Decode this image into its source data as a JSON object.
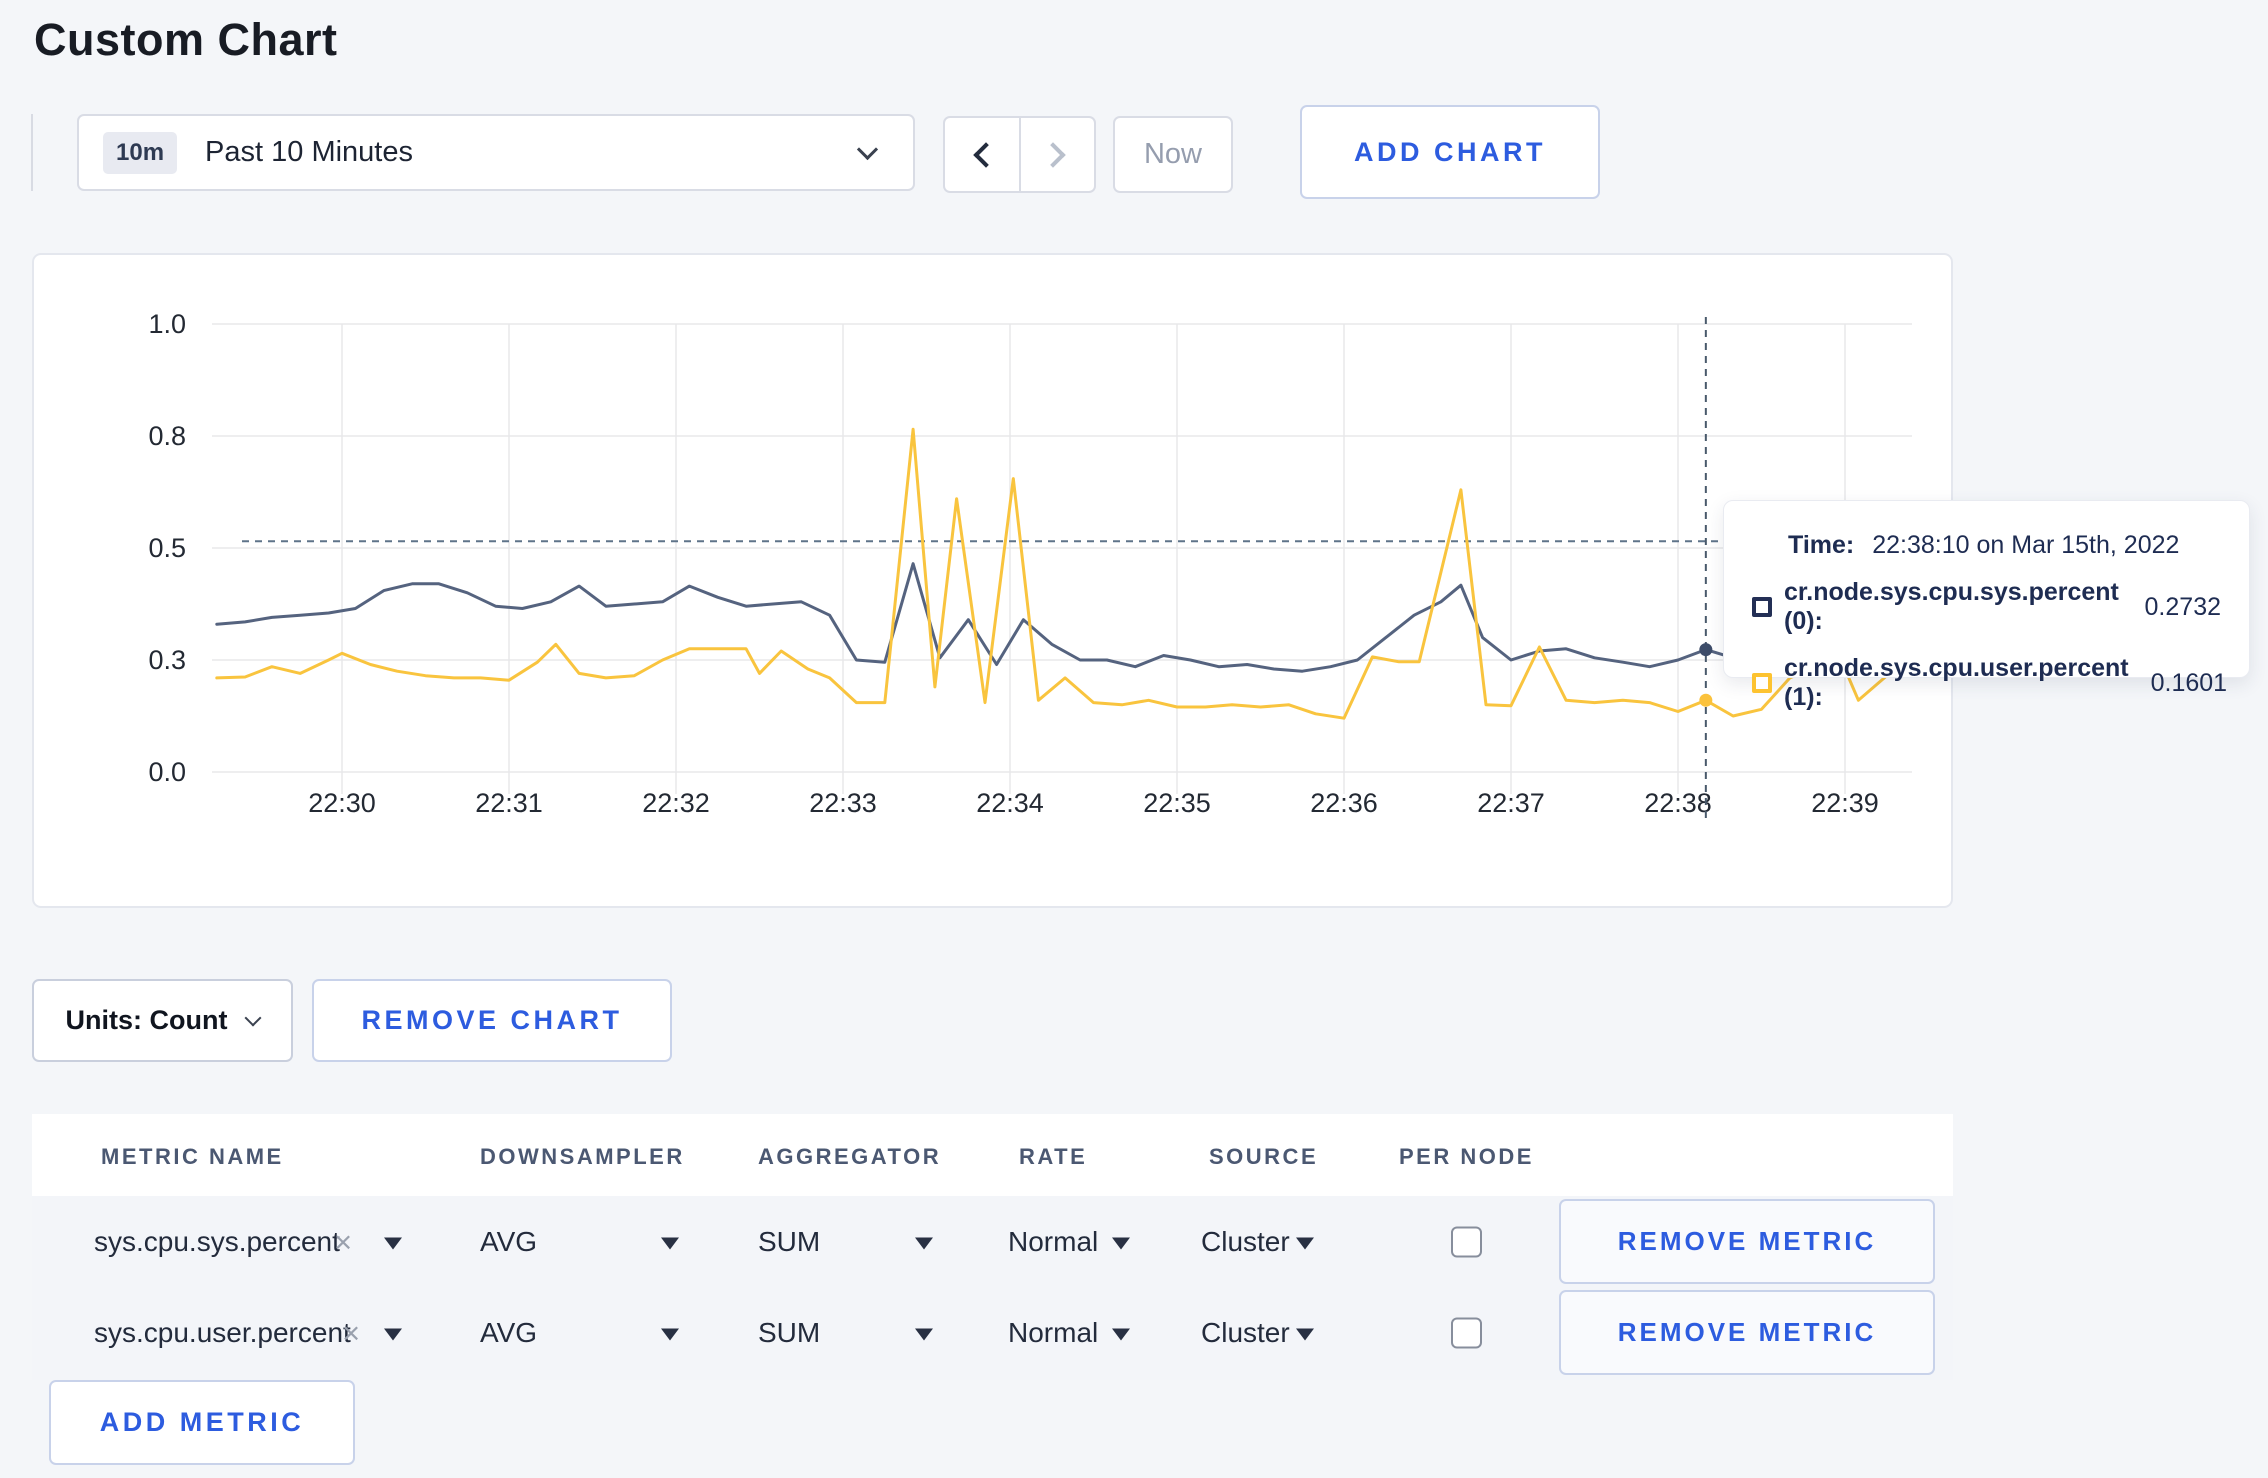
{
  "page": {
    "title": "Custom Chart"
  },
  "toolbar": {
    "time_badge": "10m",
    "time_range_label": "Past 10 Minutes",
    "now_label": "Now",
    "add_chart_label": "ADD CHART"
  },
  "tooltip": {
    "time_label": "Time:",
    "time_value": "22:38:10 on Mar 15th, 2022",
    "rows": [
      {
        "label": "cr.node.sys.cpu.sys.percent (0):",
        "value": "0.2732",
        "swatch_color": "#232f55"
      },
      {
        "label": "cr.node.sys.cpu.user.percent (1):",
        "value": "0.1601",
        "swatch_color": "#fdc330"
      }
    ]
  },
  "chart_data": {
    "type": "line",
    "title": "",
    "xlabel": "",
    "ylabel": "",
    "ylim": [
      0,
      1
    ],
    "grid": true,
    "grid_color": "#e8e8ea",
    "y_axis": {
      "ticks": [
        {
          "v": 0.0,
          "label": "0.0"
        },
        {
          "v": 0.25,
          "label": "0.3"
        },
        {
          "v": 0.5,
          "label": "0.5"
        },
        {
          "v": 0.75,
          "label": "0.8"
        },
        {
          "v": 1.0,
          "label": "1.0"
        }
      ]
    },
    "x_axis": {
      "ticks": [
        {
          "m": 0,
          "label": "22:30"
        },
        {
          "m": 1,
          "label": "22:31"
        },
        {
          "m": 2,
          "label": "22:32"
        },
        {
          "m": 3,
          "label": "22:33"
        },
        {
          "m": 4,
          "label": "22:34"
        },
        {
          "m": 5,
          "label": "22:35"
        },
        {
          "m": 6,
          "label": "22:36"
        },
        {
          "m": 7,
          "label": "22:37"
        },
        {
          "m": 8,
          "label": "22:38"
        },
        {
          "m": 9,
          "label": "22:39"
        }
      ]
    },
    "series": [
      {
        "name": "cr.node.sys.cpu.sys.percent",
        "color": "#55637f",
        "dot_color": "#3d4c69",
        "points": [
          [
            -0.75,
            0.33
          ],
          [
            -0.58,
            0.335
          ],
          [
            -0.42,
            0.345
          ],
          [
            -0.25,
            0.35
          ],
          [
            -0.08,
            0.355
          ],
          [
            0.08,
            0.365
          ],
          [
            0.25,
            0.405
          ],
          [
            0.42,
            0.42
          ],
          [
            0.58,
            0.42
          ],
          [
            0.75,
            0.4
          ],
          [
            0.92,
            0.37
          ],
          [
            1.08,
            0.365
          ],
          [
            1.25,
            0.38
          ],
          [
            1.42,
            0.415
          ],
          [
            1.58,
            0.37
          ],
          [
            1.75,
            0.375
          ],
          [
            1.92,
            0.38
          ],
          [
            2.08,
            0.415
          ],
          [
            2.25,
            0.39
          ],
          [
            2.42,
            0.37
          ],
          [
            2.58,
            0.375
          ],
          [
            2.75,
            0.38
          ],
          [
            2.92,
            0.35
          ],
          [
            3.08,
            0.25
          ],
          [
            3.25,
            0.245
          ],
          [
            3.42,
            0.465
          ],
          [
            3.58,
            0.255
          ],
          [
            3.75,
            0.34
          ],
          [
            3.92,
            0.24
          ],
          [
            4.08,
            0.34
          ],
          [
            4.25,
            0.285
          ],
          [
            4.42,
            0.25
          ],
          [
            4.58,
            0.25
          ],
          [
            4.75,
            0.235
          ],
          [
            4.92,
            0.26
          ],
          [
            5.08,
            0.25
          ],
          [
            5.25,
            0.235
          ],
          [
            5.42,
            0.24
          ],
          [
            5.58,
            0.23
          ],
          [
            5.75,
            0.225
          ],
          [
            5.92,
            0.235
          ],
          [
            6.08,
            0.25
          ],
          [
            6.25,
            0.3
          ],
          [
            6.42,
            0.35
          ],
          [
            6.58,
            0.38
          ],
          [
            6.7,
            0.417
          ],
          [
            6.83,
            0.3
          ],
          [
            7.0,
            0.25
          ],
          [
            7.17,
            0.27
          ],
          [
            7.33,
            0.275
          ],
          [
            7.5,
            0.255
          ],
          [
            7.67,
            0.245
          ],
          [
            7.83,
            0.235
          ],
          [
            8.0,
            0.25
          ],
          [
            8.1667,
            0.2732
          ],
          [
            8.33,
            0.255
          ],
          [
            8.5,
            0.26
          ],
          [
            8.67,
            0.275
          ],
          [
            8.83,
            0.305
          ],
          [
            8.97,
            0.315
          ],
          [
            9.08,
            0.29
          ],
          [
            9.25,
            0.275
          ]
        ]
      },
      {
        "name": "cr.node.sys.cpu.user.percent",
        "color": "#f9c43e",
        "dot_color": "#fbc23c",
        "points": [
          [
            -0.75,
            0.21
          ],
          [
            -0.58,
            0.212
          ],
          [
            -0.42,
            0.235
          ],
          [
            -0.25,
            0.22
          ],
          [
            -0.08,
            0.25
          ],
          [
            0,
            0.265
          ],
          [
            0.17,
            0.24
          ],
          [
            0.33,
            0.225
          ],
          [
            0.5,
            0.215
          ],
          [
            0.67,
            0.21
          ],
          [
            0.83,
            0.21
          ],
          [
            1.0,
            0.205
          ],
          [
            1.17,
            0.245
          ],
          [
            1.28,
            0.285
          ],
          [
            1.42,
            0.22
          ],
          [
            1.58,
            0.21
          ],
          [
            1.75,
            0.215
          ],
          [
            1.92,
            0.25
          ],
          [
            2.08,
            0.275
          ],
          [
            2.25,
            0.275
          ],
          [
            2.42,
            0.275
          ],
          [
            2.5,
            0.22
          ],
          [
            2.63,
            0.27
          ],
          [
            2.79,
            0.23
          ],
          [
            2.92,
            0.21
          ],
          [
            3.08,
            0.155
          ],
          [
            3.25,
            0.155
          ],
          [
            3.42,
            0.765
          ],
          [
            3.55,
            0.19
          ],
          [
            3.68,
            0.61
          ],
          [
            3.85,
            0.155
          ],
          [
            4.02,
            0.655
          ],
          [
            4.17,
            0.16
          ],
          [
            4.33,
            0.21
          ],
          [
            4.5,
            0.155
          ],
          [
            4.67,
            0.15
          ],
          [
            4.83,
            0.16
          ],
          [
            5.0,
            0.145
          ],
          [
            5.17,
            0.145
          ],
          [
            5.33,
            0.15
          ],
          [
            5.5,
            0.145
          ],
          [
            5.67,
            0.15
          ],
          [
            5.83,
            0.13
          ],
          [
            6.0,
            0.12
          ],
          [
            6.17,
            0.257
          ],
          [
            6.33,
            0.246
          ],
          [
            6.45,
            0.246
          ],
          [
            6.7,
            0.63
          ],
          [
            6.85,
            0.15
          ],
          [
            7.0,
            0.148
          ],
          [
            7.17,
            0.279
          ],
          [
            7.33,
            0.16
          ],
          [
            7.5,
            0.155
          ],
          [
            7.67,
            0.16
          ],
          [
            7.83,
            0.155
          ],
          [
            8.0,
            0.135
          ],
          [
            8.1667,
            0.1601
          ],
          [
            8.33,
            0.125
          ],
          [
            8.5,
            0.14
          ],
          [
            8.67,
            0.21
          ],
          [
            8.83,
            0.235
          ],
          [
            9.0,
            0.23
          ],
          [
            9.08,
            0.16
          ],
          [
            9.25,
            0.215
          ]
        ]
      }
    ],
    "hover": {
      "minute": 8.1667,
      "guide_value": 0.515,
      "crosshair_color": "#49596b",
      "points": [
        {
          "series": 0,
          "v": 0.2732
        },
        {
          "series": 1,
          "v": 0.1601
        }
      ]
    },
    "legend_position": "tooltip-only"
  },
  "controls": {
    "units_label": "Units: Count",
    "remove_chart_label": "REMOVE CHART",
    "add_metric_label": "ADD METRIC"
  },
  "icons": {
    "remove_x": "×"
  },
  "table": {
    "headers": [
      "METRIC NAME",
      "DOWNSAMPLER",
      "AGGREGATOR",
      "RATE",
      "SOURCE",
      "PER NODE"
    ],
    "rows": [
      {
        "metric": "sys.cpu.sys.percent",
        "downsampler": "AVG",
        "aggregator": "SUM",
        "rate": "Normal",
        "source": "Cluster",
        "per_node": false,
        "remove_label": "REMOVE METRIC"
      },
      {
        "metric": "sys.cpu.user.percent",
        "downsampler": "AVG",
        "aggregator": "SUM",
        "rate": "Normal",
        "source": "Cluster",
        "per_node": false,
        "remove_label": "REMOVE METRIC"
      }
    ]
  }
}
